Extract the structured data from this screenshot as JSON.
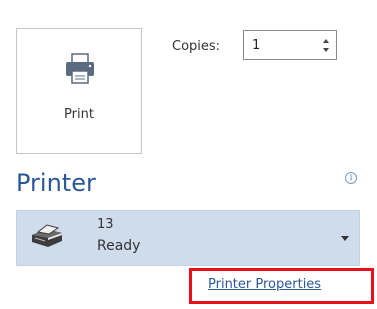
{
  "print_button": {
    "label": "Print",
    "icon": "printer-icon"
  },
  "copies": {
    "label": "Copies:",
    "value": "1"
  },
  "printer_section": {
    "heading": "Printer",
    "info_icon": "info-icon",
    "info_glyph": "i",
    "selected_printer": {
      "name": "13",
      "status": "Ready",
      "icon": "printer-device-icon"
    },
    "properties_link": "Printer Properties"
  },
  "colors": {
    "accent": "#2b579a",
    "dropdown_bg": "#cfdcec",
    "highlight": "#e8111a"
  }
}
